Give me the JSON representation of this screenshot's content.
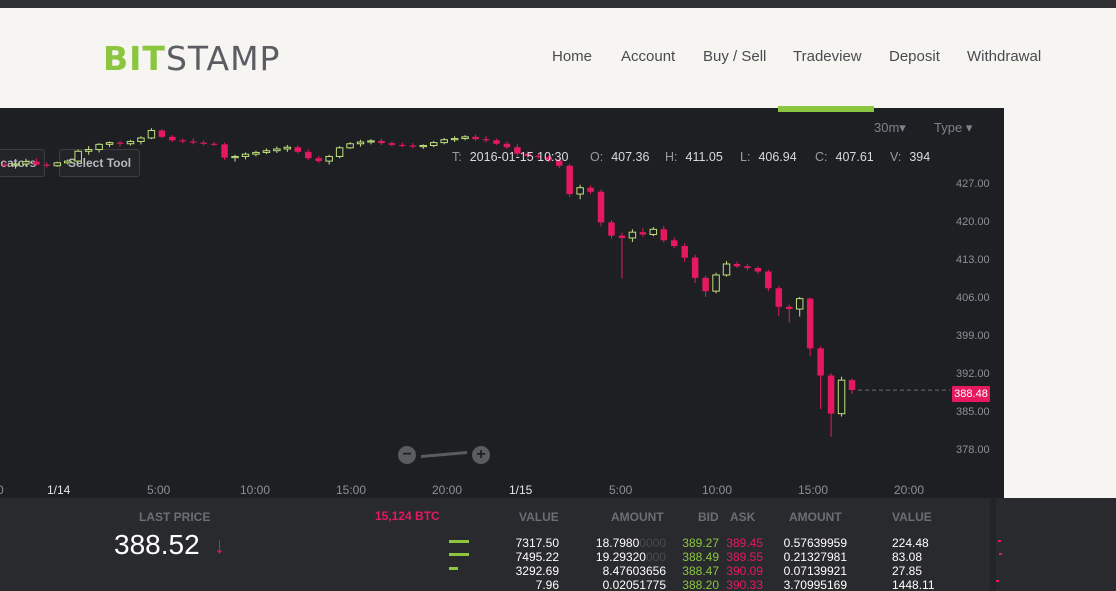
{
  "brand": {
    "part1": "BIT",
    "part2": "STAMP"
  },
  "nav": [
    {
      "label": "Home"
    },
    {
      "label": "Account"
    },
    {
      "label": "Buy / Sell"
    },
    {
      "label": "Tradeview"
    },
    {
      "label": "Deposit"
    },
    {
      "label": "Withdrawal"
    }
  ],
  "active_nav": "Tradeview",
  "chart_controls": {
    "interval": "30m",
    "interval_caret": "▾",
    "type": "Type",
    "type_caret": "▾",
    "indicators": "Indicators",
    "select_tool": "Select Tool"
  },
  "ohlc": {
    "t_label": "T:",
    "t_value": "2016-01-15 10:30",
    "o_label": "O:",
    "o_value": "407.36",
    "h_label": "H:",
    "h_value": "411.05",
    "l_label": "L:",
    "l_value": "406.94",
    "c_label": "C:",
    "c_value": "407.61",
    "v_label": "V:",
    "v_value": "394"
  },
  "chart_data": {
    "type": "candlestick",
    "y_ticks": [
      "427.00",
      "420.00",
      "413.00",
      "406.00",
      "399.00",
      "392.00",
      "385.00",
      "378.00"
    ],
    "ylim": [
      375,
      434
    ],
    "x_ticks": [
      "0",
      "1/14",
      "5:00",
      "10:00",
      "15:00",
      "20:00",
      "1/15",
      "5:00",
      "10:00",
      "15:00",
      "20:00"
    ],
    "last_price_label": "388.48",
    "up_color": "#bfe07a",
    "down_color": "#e6195f",
    "candles": [
      [
        427.5,
        428.0,
        427.0,
        427.4
      ],
      [
        427.4,
        427.9,
        426.8,
        427.6
      ],
      [
        427.6,
        428.5,
        427.2,
        428.0
      ],
      [
        428.0,
        428.6,
        427.3,
        427.5
      ],
      [
        427.5,
        427.9,
        427.0,
        427.3
      ],
      [
        427.3,
        428.0,
        427.1,
        427.8
      ],
      [
        427.8,
        428.4,
        427.5,
        428.1
      ],
      [
        428.1,
        430.1,
        427.9,
        429.8
      ],
      [
        429.8,
        430.7,
        429.2,
        430.1
      ],
      [
        430.1,
        431.2,
        429.6,
        431.0
      ],
      [
        431.0,
        431.5,
        430.5,
        431.3
      ],
      [
        431.3,
        431.6,
        430.6,
        431.1
      ],
      [
        431.1,
        431.8,
        430.8,
        431.5
      ],
      [
        431.5,
        432.4,
        431.0,
        432.1
      ],
      [
        432.1,
        433.8,
        431.9,
        433.4
      ],
      [
        433.4,
        433.6,
        432.0,
        432.3
      ],
      [
        432.3,
        432.6,
        431.4,
        431.7
      ],
      [
        431.7,
        432.0,
        431.2,
        431.5
      ],
      [
        431.5,
        432.0,
        431.0,
        431.3
      ],
      [
        431.3,
        431.7,
        430.8,
        431.1
      ],
      [
        431.1,
        431.4,
        430.7,
        431.0
      ],
      [
        431.0,
        431.3,
        428.3,
        428.7
      ],
      [
        428.7,
        429.2,
        428.0,
        428.9
      ],
      [
        428.9,
        429.6,
        428.4,
        429.3
      ],
      [
        429.3,
        429.9,
        428.9,
        429.6
      ],
      [
        429.6,
        430.3,
        429.3,
        429.9
      ],
      [
        429.9,
        430.6,
        429.5,
        430.2
      ],
      [
        430.2,
        430.9,
        429.7,
        430.5
      ],
      [
        430.5,
        430.8,
        429.4,
        429.7
      ],
      [
        429.7,
        430.1,
        428.3,
        428.6
      ],
      [
        428.6,
        429.0,
        427.8,
        428.1
      ],
      [
        428.1,
        429.2,
        427.5,
        428.9
      ],
      [
        428.9,
        430.7,
        428.6,
        430.4
      ],
      [
        430.4,
        431.4,
        430.2,
        431.1
      ],
      [
        431.1,
        431.8,
        430.6,
        431.4
      ],
      [
        431.4,
        431.9,
        431.0,
        431.6
      ],
      [
        431.6,
        432.0,
        430.9,
        431.2
      ],
      [
        431.2,
        431.5,
        430.6,
        430.9
      ],
      [
        430.9,
        431.3,
        430.5,
        430.8
      ],
      [
        430.8,
        431.2,
        430.3,
        430.6
      ],
      [
        430.6,
        431.0,
        430.2,
        430.8
      ],
      [
        430.8,
        431.6,
        430.5,
        431.3
      ],
      [
        431.3,
        432.1,
        431.0,
        431.8
      ],
      [
        431.8,
        432.4,
        431.4,
        432.0
      ],
      [
        432.0,
        432.6,
        431.7,
        432.3
      ],
      [
        432.3,
        432.7,
        431.6,
        431.9
      ],
      [
        431.9,
        432.4,
        431.3,
        431.7
      ],
      [
        431.7,
        432.0,
        430.9,
        431.1
      ],
      [
        431.1,
        431.5,
        430.2,
        430.5
      ],
      [
        430.5,
        431.0,
        429.0,
        429.4
      ],
      [
        429.4,
        429.8,
        428.6,
        429.0
      ],
      [
        429.0,
        429.4,
        428.5,
        428.8
      ],
      [
        428.8,
        429.1,
        427.9,
        428.2
      ],
      [
        428.2,
        428.6,
        426.9,
        427.3
      ],
      [
        427.3,
        427.6,
        421.9,
        422.4
      ],
      [
        422.4,
        424.0,
        421.5,
        423.5
      ],
      [
        423.5,
        423.9,
        422.4,
        422.8
      ],
      [
        422.8,
        423.2,
        416.8,
        417.5
      ],
      [
        417.5,
        417.9,
        414.7,
        415.2
      ],
      [
        415.2,
        415.7,
        407.8,
        414.8
      ],
      [
        414.8,
        416.3,
        414.1,
        415.8
      ],
      [
        415.8,
        416.5,
        415.0,
        415.4
      ],
      [
        415.4,
        416.7,
        415.1,
        416.3
      ],
      [
        416.3,
        416.9,
        414.0,
        414.4
      ],
      [
        414.4,
        414.9,
        413.0,
        413.4
      ],
      [
        413.4,
        413.9,
        410.7,
        411.4
      ],
      [
        411.4,
        411.9,
        407.0,
        407.9
      ],
      [
        407.9,
        408.3,
        404.6,
        405.6
      ],
      [
        405.6,
        408.8,
        405.2,
        408.4
      ],
      [
        408.4,
        410.8,
        408.1,
        410.3
      ],
      [
        410.3,
        410.7,
        409.6,
        409.9
      ],
      [
        409.9,
        410.3,
        409.2,
        409.6
      ],
      [
        409.6,
        409.9,
        408.6,
        409.0
      ],
      [
        409.0,
        409.3,
        405.6,
        406.1
      ],
      [
        406.1,
        406.5,
        401.3,
        402.9
      ],
      [
        402.9,
        403.3,
        400.2,
        402.5
      ],
      [
        402.5,
        404.6,
        401.2,
        404.3
      ],
      [
        404.3,
        404.5,
        394.3,
        395.7
      ],
      [
        395.7,
        396.1,
        385.2,
        391.0
      ],
      [
        391.0,
        391.4,
        380.4,
        384.4
      ],
      [
        384.4,
        390.8,
        383.9,
        390.2
      ],
      [
        390.2,
        390.5,
        387.8,
        388.5
      ]
    ]
  },
  "zoom": {
    "minus": "−",
    "plus": "+"
  },
  "bottom": {
    "last_price_label": "LAST PRICE",
    "last_price": "388.52",
    "last_price_arrow": "↓",
    "volume": "15,124 BTC"
  },
  "orderbook": {
    "headers": {
      "value_bid": "VALUE",
      "amount_bid": "AMOUNT",
      "bid": "BID",
      "ask": "ASK",
      "amount_ask": "AMOUNT",
      "value_ask": "VALUE"
    },
    "rows": [
      {
        "value_bid": "7317.50",
        "amount_bid_main": "18.7980",
        "amount_bid_tail": "0000",
        "bid": "389.27",
        "ask": "389.45",
        "amount_ask": "0.57639959",
        "value_ask": "224.48"
      },
      {
        "value_bid": "7495.22",
        "amount_bid_main": "19.29320",
        "amount_bid_tail": "000",
        "bid": "388.49",
        "ask": "389.55",
        "amount_ask": "0.21327981",
        "value_ask": "83.08"
      },
      {
        "value_bid": "3292.69",
        "amount_bid_main": "8.47603656",
        "amount_bid_tail": "",
        "bid": "388.47",
        "ask": "390.09",
        "amount_ask": "0.07139921",
        "value_ask": "27.85"
      },
      {
        "value_bid": "7.96",
        "amount_bid_main": "0.02051775",
        "amount_bid_tail": "",
        "bid": "388.20",
        "ask": "390.33",
        "amount_ask": "3.70995169",
        "value_ask": "1448.11"
      }
    ]
  }
}
